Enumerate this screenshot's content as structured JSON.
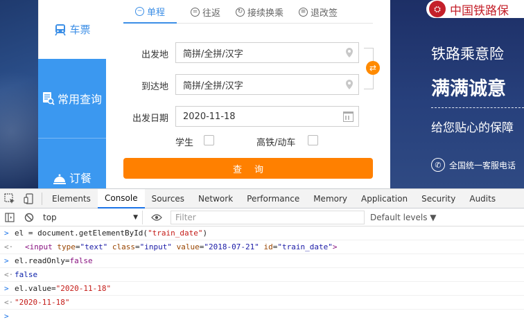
{
  "sidebar": {
    "items": [
      {
        "label": "车票",
        "icon": "train-icon"
      },
      {
        "label": "常用查询",
        "icon": "document-search-icon"
      },
      {
        "label": "订餐",
        "icon": "meal-icon"
      }
    ]
  },
  "tabs": [
    {
      "label": "单程",
      "icon": "minus-circle-icon"
    },
    {
      "label": "往返",
      "icon": "equals-circle-icon"
    },
    {
      "label": "接续换乘",
      "icon": "transfer-circle-icon"
    },
    {
      "label": "退改签",
      "icon": "list-circle-icon"
    }
  ],
  "form": {
    "from_label": "出发地",
    "from_value": "简拼/全拼/汉字",
    "to_label": "到达地",
    "to_value": "简拼/全拼/汉字",
    "date_label": "出发日期",
    "date_value": "2020-11-18",
    "student_label": "学生",
    "hsr_label": "高铁/动车",
    "query_button": "查询"
  },
  "ad": {
    "logo_text": "中国铁路保",
    "line1": "铁路乘意险",
    "line2": "满满诚意",
    "line3": "给您贴心的保障",
    "phone_text": "全国统一客服电话"
  },
  "devtools": {
    "tabs": [
      "Elements",
      "Console",
      "Sources",
      "Network",
      "Performance",
      "Memory",
      "Application",
      "Security",
      "Audits"
    ],
    "active_tab": "Console",
    "context": "top",
    "filter_placeholder": "Filter",
    "levels": "Default levels ▼",
    "lines": {
      "l1_pre": "el = document.getElementById(",
      "l1_str": "\"train_date\"",
      "l1_post": ")",
      "l2_tag_open": "<input",
      "l2_attr1": "type",
      "l2_val1": "\"text\"",
      "l2_attr2": "class",
      "l2_val2": "\"input\"",
      "l2_attr3": "value",
      "l2_val3": "\"2018-07-21\"",
      "l2_attr4": "id",
      "l2_val4": "\"train_date\"",
      "l2_tag_close": ">",
      "l3_pre": "el.readOnly=",
      "l3_kw": "false",
      "l4_out": "false",
      "l5_pre": "el.value=",
      "l5_str": "\"2020-11-18\"",
      "l6_out": "\"2020-11-18\""
    }
  },
  "colors": {
    "primary_blue": "#3b98f0",
    "orange": "#ff8000",
    "rail_red": "#c4202a"
  }
}
